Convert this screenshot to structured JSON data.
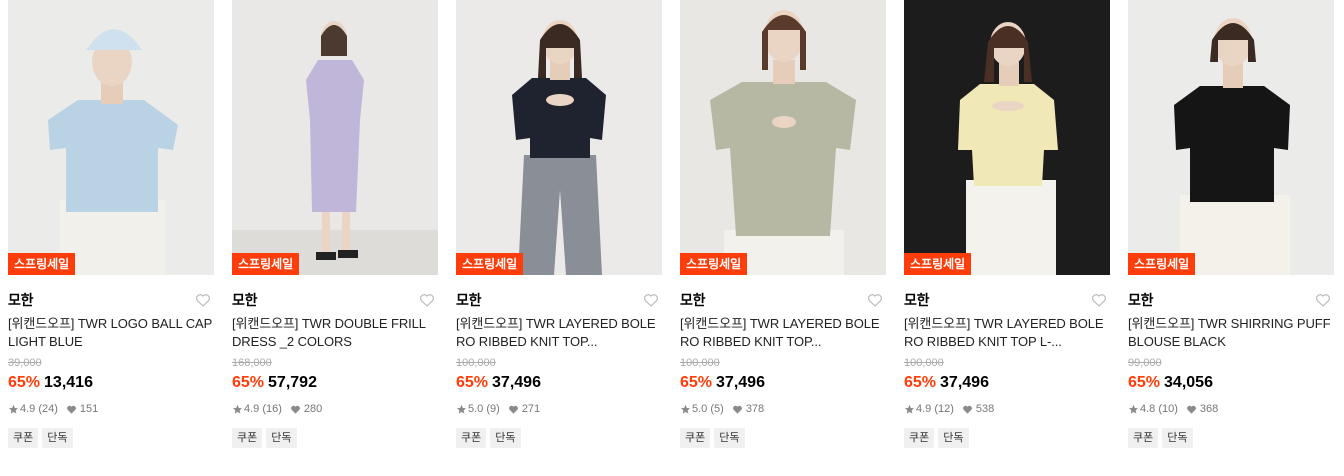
{
  "sale_badge_label": "스프링세일",
  "tags": {
    "coupon": "쿠폰",
    "exclusive": "단독"
  },
  "colors": {
    "accent": "#ff3d0a",
    "heart_outline": "#bbbbbb",
    "meta_gray": "#777777"
  },
  "products": [
    {
      "brand": "모한",
      "title": "[위캔드오프] TWR LOGO BALL CAP LIGHT BLUE",
      "original_price": "39,000",
      "discount": "65%",
      "price": "13,416",
      "rating": "4.9",
      "reviews": "(24)",
      "likes": "151",
      "image": {
        "bg": "#ebebea",
        "garment": "#b9d2e4",
        "bottom": "#f2f0ea",
        "hat": "#cfe0ee"
      }
    },
    {
      "brand": "모한",
      "title": "[위캔드오프] TWR DOUBLE FRILL DRESS _2 COLORS",
      "original_price": "168,000",
      "discount": "65%",
      "price": "57,792",
      "rating": "4.9",
      "reviews": "(16)",
      "likes": "280",
      "image": {
        "bg": "#e9e8e6",
        "garment": "#bfb6d9",
        "bottom": "#bfb6d9",
        "hat": ""
      }
    },
    {
      "brand": "모한",
      "title": "[위캔드오프] TWR LAYERED BOLERO RIBBED KNIT TOP...",
      "original_price": "100,000",
      "discount": "65%",
      "price": "37,496",
      "rating": "5.0",
      "reviews": "(9)",
      "likes": "271",
      "image": {
        "bg": "#ebeae8",
        "garment": "#1f2330",
        "bottom": "#8a8e96",
        "hat": ""
      }
    },
    {
      "brand": "모한",
      "title": "[위캔드오프] TWR LAYERED BOLERO RIBBED KNIT TOP...",
      "original_price": "100,000",
      "discount": "65%",
      "price": "37,496",
      "rating": "5.0",
      "reviews": "(5)",
      "likes": "378",
      "image": {
        "bg": "#e8e7e4",
        "garment": "#b7b8a3",
        "bottom": "#f3f1ec",
        "hat": ""
      }
    },
    {
      "brand": "모한",
      "title": "[위캔드오프] TWR LAYERED BOLERO RIBBED KNIT TOP L-...",
      "original_price": "100,000",
      "discount": "65%",
      "price": "37,496",
      "rating": "4.9",
      "reviews": "(12)",
      "likes": "538",
      "image": {
        "bg": "#1c1c1c",
        "garment": "#f1e8b8",
        "bottom": "#f4f2ec",
        "hat": ""
      }
    },
    {
      "brand": "모한",
      "title": "[위캔드오프] TWR SHIRRING PUFF BLOUSE BLACK",
      "original_price": "99,000",
      "discount": "65%",
      "price": "34,056",
      "rating": "4.8",
      "reviews": "(10)",
      "likes": "368",
      "image": {
        "bg": "#ebebea",
        "garment": "#151515",
        "bottom": "#f3f1ea",
        "hat": ""
      }
    }
  ]
}
